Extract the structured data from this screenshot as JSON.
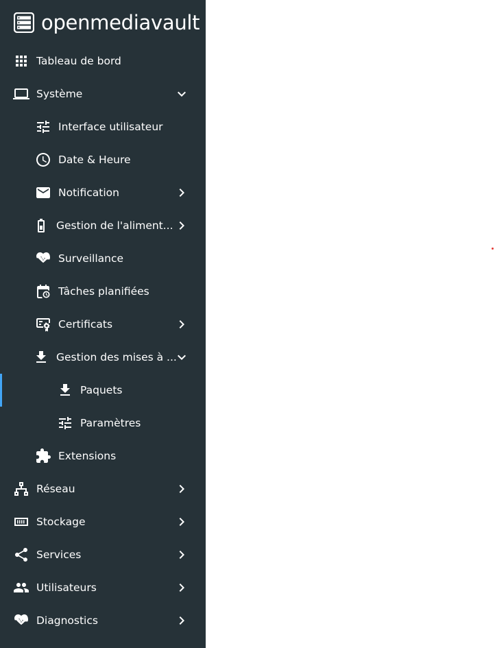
{
  "app": {
    "logo_text": "openmediavault"
  },
  "nav": {
    "dashboard": "Tableau de bord",
    "system": "Système",
    "workbench": "Interface utilisateur",
    "datetime": "Date & Heure",
    "notification": "Notification",
    "power": "Gestion de l'aliment...",
    "monitoring": "Surveillance",
    "cron": "Tâches planifiées",
    "certificates": "Certificats",
    "updates": "Gestion des mises à ...",
    "packages": "Paquets",
    "settings": "Paramètres",
    "plugins": "Extensions",
    "network": "Réseau",
    "storage": "Stockage",
    "services": "Services",
    "users": "Utilisateurs",
    "diagnostics": "Diagnostics"
  },
  "colors": {
    "sidebar_bg": "#263238",
    "active_indicator": "#42a5f5",
    "text": "#ffffff"
  },
  "icons": {
    "dashboard": "grid-icon",
    "system": "laptop-icon",
    "workbench": "tune-icon",
    "datetime": "clock-icon",
    "notification": "mail-icon",
    "power": "battery-icon",
    "monitoring": "pulse-heart-icon",
    "cron": "calendar-clock-icon",
    "certificates": "certificate-icon",
    "updates": "download-icon",
    "packages": "download-icon",
    "settings": "tune-icon",
    "plugins": "puzzle-icon",
    "network": "network-icon",
    "storage": "storage-icon",
    "services": "share-icon",
    "users": "users-icon",
    "diagnostics": "pulse-heart-icon"
  }
}
